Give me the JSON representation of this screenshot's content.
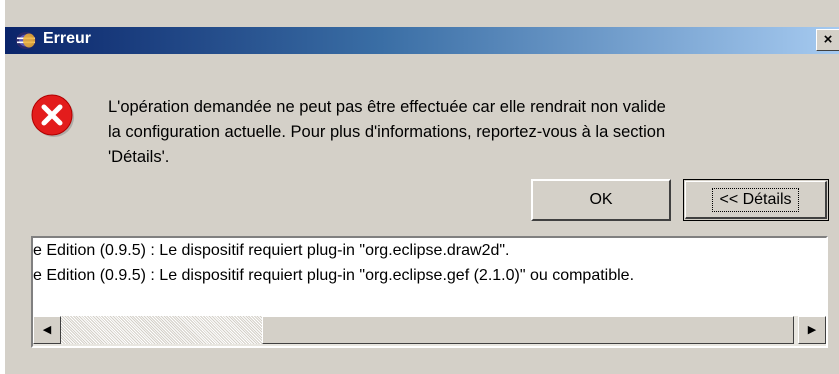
{
  "window": {
    "title": "Erreur",
    "close_label": "×"
  },
  "message": {
    "line1": "L'opération demandée ne peut pas être effectuée car elle rendrait non valide",
    "line2": "la configuration actuelle. Pour plus d'informations, reportez-vous à la section",
    "line3": "'Détails'."
  },
  "buttons": {
    "ok_label": "OK",
    "details_label": "<< Détails"
  },
  "details": {
    "lines": [
      "e Edition (0.9.5) : Le dispositif requiert plug-in \"org.eclipse.draw2d\".",
      "e Edition (0.9.5) : Le dispositif requiert plug-in \"org.eclipse.gef (2.1.0)\" ou compatible."
    ]
  },
  "scrollbar": {
    "left_arrow": "◀",
    "right_arrow": "▶"
  },
  "colors": {
    "titlebar_start": "#0a246a",
    "titlebar_end": "#a6caf0",
    "dialog_bg": "#d4d0c8",
    "error_red": "#e31c1c"
  },
  "icons": {
    "app": "eclipse-icon",
    "error": "error-icon"
  }
}
